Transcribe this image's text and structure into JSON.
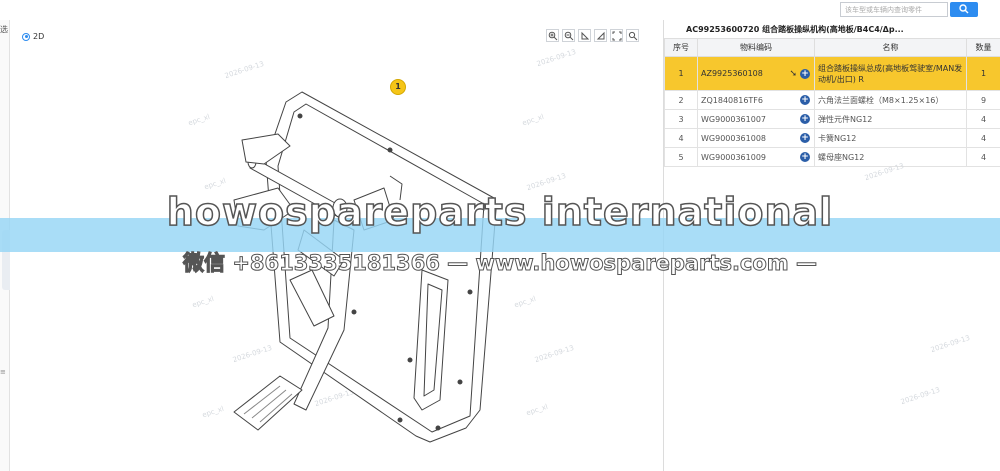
{
  "search": {
    "placeholder": "该车型或车辆内查询零件"
  },
  "sidebar": {
    "top_label": "选"
  },
  "viewer": {
    "mode_label": "2D",
    "callout": "1",
    "watermark": "2026-09-13",
    "watermark_user": "epc_xl",
    "tools": [
      "zoom-in-icon",
      "zoom-out-icon",
      "rotate-left-icon",
      "rotate-right-icon",
      "fit-icon",
      "reset-icon"
    ]
  },
  "panel": {
    "title": "AC99253600720  组合踏板操纵机构(高地板/B4C4/Δp...",
    "columns": [
      "序号",
      "物料编码",
      "名称",
      "数量"
    ],
    "rows": [
      {
        "idx": "1",
        "code": "AZ9925360108",
        "name": "组合踏板操纵总成(高地板驾驶室/MAN发动机/出口) R",
        "qty": "1",
        "selected": true
      },
      {
        "idx": "2",
        "code": "ZQ1840816TF6",
        "name": "六角法兰面螺栓（M8×1.25×16）",
        "qty": "9"
      },
      {
        "idx": "3",
        "code": "WG9000361007",
        "name": "弹性元件NG12",
        "qty": "4"
      },
      {
        "idx": "4",
        "code": "WG9000361008",
        "name": "卡簧NG12",
        "qty": "4"
      },
      {
        "idx": "5",
        "code": "WG9000361009",
        "name": "螺母座NG12",
        "qty": "4"
      }
    ]
  },
  "overlay": {
    "title": "howospareparts international",
    "subtitle": "微信 +8613335181366 — www.howospareparts.com —"
  }
}
